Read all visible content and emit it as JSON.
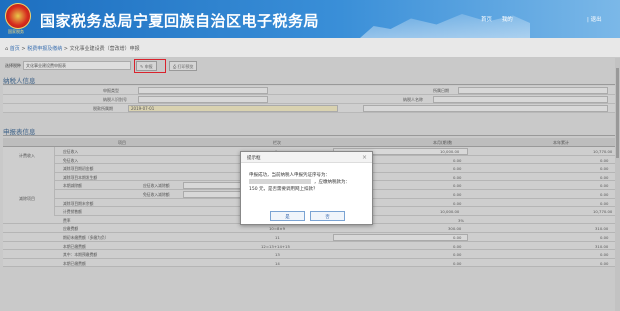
{
  "header": {
    "title": "国家税务总局宁夏回族自治区电子税务局",
    "emblem_text": "国家税务",
    "nav": [
      "首页",
      "我的"
    ],
    "exit": "| 退出"
  },
  "breadcrumb": {
    "home": "首页",
    "sep": ">",
    "path1": "税费申报及缴纳",
    "path2": "文化事业建设费（营改增）申报"
  },
  "toolbar": {
    "label": "选择税种",
    "select_value": "文化事业建设费申报表",
    "btn_declare": "申报",
    "btn_print": "打印预览"
  },
  "taxpayer": {
    "section": "纳税人信息",
    "fields": [
      "申报类型",
      "纳税人识别号",
      "纳税人名称",
      "税款所属期",
      "所属日期"
    ],
    "period_value": "2019-07-01"
  },
  "declare": {
    "section": "申报表信息",
    "col_item": "项目",
    "col_line": "栏次",
    "col_this": "本月(期)数",
    "col_year": "本年累计"
  },
  "rows": [
    {
      "group": "计费收入",
      "item": "应征收入",
      "line": "1",
      "v1": "10,000.00",
      "v2": "10,770.00"
    },
    {
      "item": "免征收入",
      "line": "2",
      "v1": "0.00",
      "v2": "0.00"
    },
    {
      "item": "减除项目期初金额",
      "line": "3",
      "v1": "0.00",
      "v2": "0.00"
    },
    {
      "item": "减除项目本期发生额",
      "line": "4",
      "v1": "0.00",
      "v2": "0.00"
    },
    {
      "group": "减除项目",
      "item": "本期减除额",
      "sub": "应征收入减除额",
      "line": "5",
      "v1": "0.00",
      "v2": "0.00"
    },
    {
      "sub": "免征收入减除额",
      "line": "6",
      "v1": "0.00",
      "v2": "0.00"
    },
    {
      "item": "减除项目期末余额",
      "line": "7",
      "v1": "0.00",
      "v2": "0.00"
    },
    {
      "item": "计费销售额",
      "line": "8=1-5",
      "v1": "10,000.00",
      "v2": "10,770.00"
    },
    {
      "item": "费率",
      "line": "9",
      "v1": "3%",
      "v2": ""
    },
    {
      "item": "应缴费额",
      "line": "10=8×9",
      "v1": "300.00",
      "v2": "310.00"
    },
    {
      "item": "期初未缴费额（多缴为负）",
      "line": "11",
      "v1": "0.00",
      "v2": "0.00"
    },
    {
      "item": "本期已缴费额",
      "line": "12=13+14+15",
      "v1": "0.00",
      "v2": "310.00"
    },
    {
      "item": "其中：本期预缴费额",
      "line": "13",
      "v1": "0.00",
      "v2": "0.00"
    },
    {
      "item": "本期已缴费额",
      "line": "14",
      "v1": "0.00",
      "v2": "0.00"
    }
  ],
  "dialog": {
    "title": "提示框",
    "close": "×",
    "line1": "申报成功，当前纳税人申报凭证序号为：",
    "line2": "，应缴纳税款为：",
    "line3": "150 元，是否需要调用网上扣款？",
    "ok": "是",
    "cancel": "否"
  }
}
